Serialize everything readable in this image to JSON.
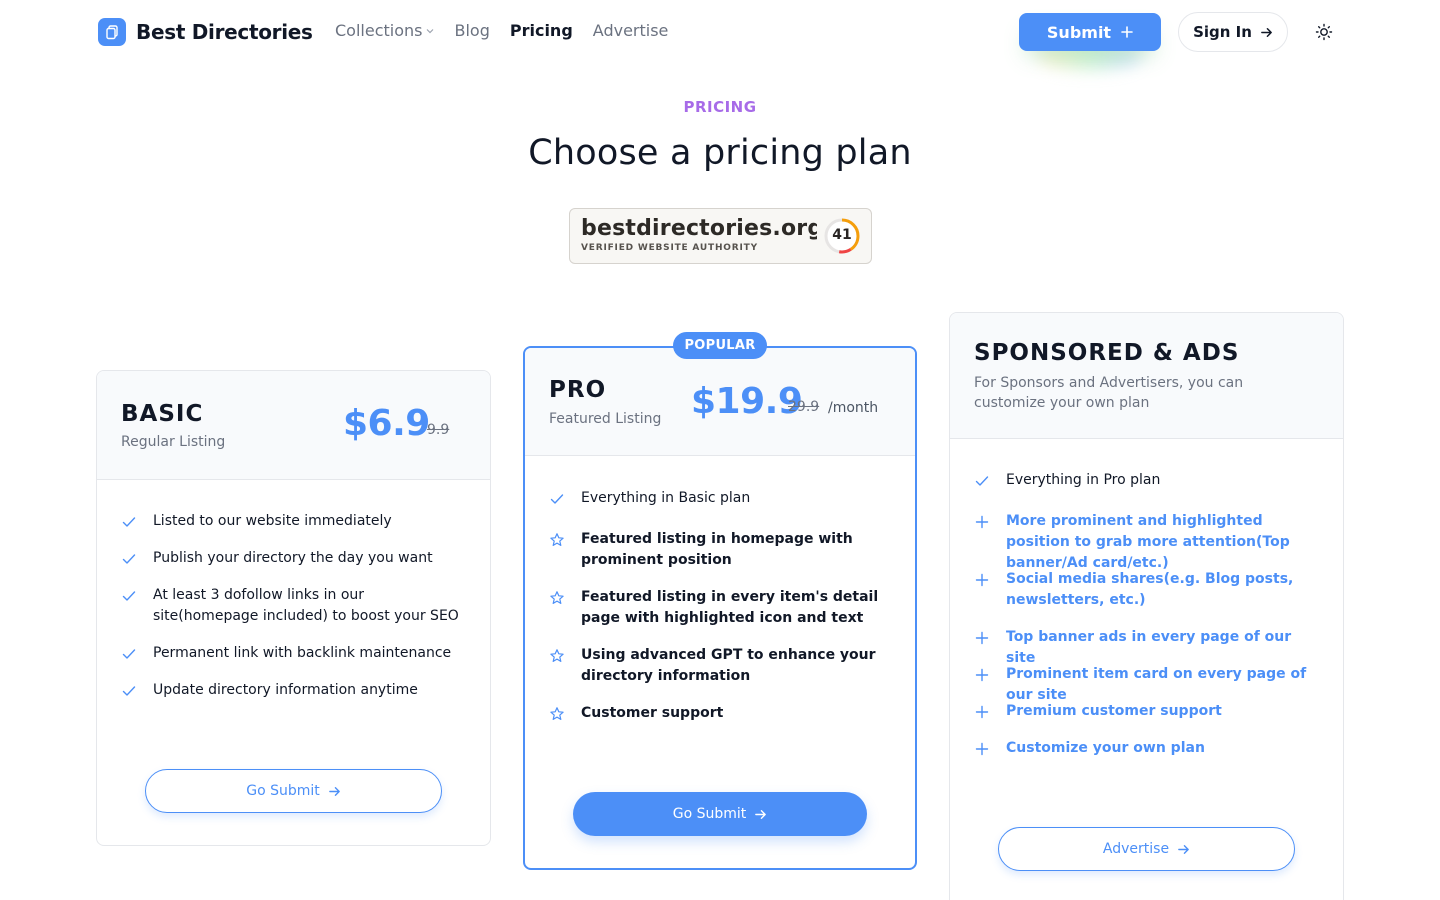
{
  "header": {
    "brand": "Best Directories",
    "nav": [
      {
        "label": "Collections",
        "has_dropdown": true,
        "active": false
      },
      {
        "label": "Blog",
        "active": false
      },
      {
        "label": "Pricing",
        "active": true
      },
      {
        "label": "Advertise",
        "active": false
      }
    ],
    "submit_label": "Submit",
    "signin_label": "Sign In"
  },
  "hero": {
    "eyebrow": "PRICING",
    "title": "Choose a pricing plan"
  },
  "badge": {
    "domain": "bestdirectories.org",
    "subtitle": "VERIFIED WEBSITE AUTHORITY",
    "score": "41"
  },
  "plans": {
    "basic": {
      "name": "BASIC",
      "subtitle": "Regular Listing",
      "price": "$6.9",
      "old_price": "9.9",
      "features": [
        "Listed to our website immediately",
        "Publish your directory the day you want",
        "At least 3 dofollow links in our site(homepage included) to boost your SEO",
        "Permanent link with backlink maintenance",
        "Update directory information anytime"
      ],
      "cta": "Go Submit"
    },
    "pro": {
      "badge": "POPULAR",
      "name": "PRO",
      "subtitle": "Featured Listing",
      "price": "$19.9",
      "old_price": "29.9",
      "period": "/month",
      "features": [
        "Everything in Basic plan",
        "Featured listing in homepage with prominent position",
        "Featured listing in every item's detail page with highlighted icon and text",
        "Using advanced GPT to enhance your directory information",
        "Customer support"
      ],
      "cta": "Go Submit"
    },
    "sponsored": {
      "name": "SPONSORED & ADS",
      "subtitle": "For Sponsors and Advertisers, you can customize your own plan",
      "features": [
        "Everything in Pro plan",
        "More prominent and highlighted position to grab more attention(Top banner/Ad card/etc.)",
        "Social media shares(e.g. Blog posts, newsletters, etc.)",
        "Top banner ads in every page of our site",
        "Prominent item card on every page of our site",
        "Premium customer support",
        "Customize your own plan"
      ],
      "cta": "Advertise"
    }
  },
  "colors": {
    "accent": "#4c8ff7",
    "eyebrow": "#a76be8",
    "text": "#111827",
    "muted": "#6b7280"
  }
}
